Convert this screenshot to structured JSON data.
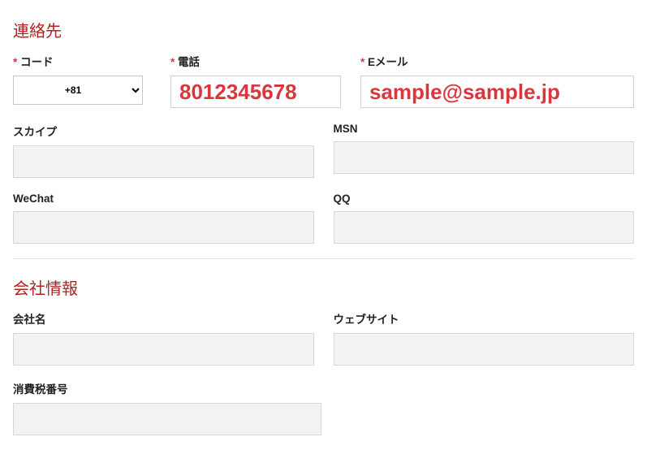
{
  "contact": {
    "title": "連絡先",
    "code_label": "コード",
    "code_value": "+81",
    "phone_label": "電話",
    "phone_value": "8012345678",
    "email_label": "Eメール",
    "email_value": "sample@sample.jp",
    "skype_label": "スカイプ",
    "skype_value": "",
    "msn_label": "MSN",
    "msn_value": "",
    "wechat_label": "WeChat",
    "wechat_value": "",
    "qq_label": "QQ",
    "qq_value": ""
  },
  "company": {
    "title": "会社情報",
    "name_label": "会社名",
    "name_value": "",
    "website_label": "ウェブサイト",
    "website_value": "",
    "vat_label": "消費税番号",
    "vat_value": ""
  }
}
